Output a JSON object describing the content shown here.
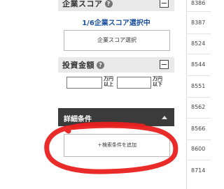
{
  "company_score": {
    "title": "企業スコア",
    "selected_count": "1/6企業スコア選択中",
    "select_button": "企業スコア選択"
  },
  "investment_amount": {
    "title": "投資金額",
    "min_unit": "万円\n以上",
    "max_unit": "万円\n以下",
    "min_value": "",
    "max_value": ""
  },
  "detail_conditions": {
    "title": "詳細条件",
    "add_button": "＋検索条件を追加"
  },
  "numbers": [
    "8386",
    "8387",
    "8524",
    "8544",
    "8551",
    "8562",
    "8566",
    "8600",
    "8714"
  ],
  "colors": {
    "scribble": "#e8201f",
    "link_blue": "#1a4f9c",
    "dark_bar": "#3b3b3b"
  }
}
